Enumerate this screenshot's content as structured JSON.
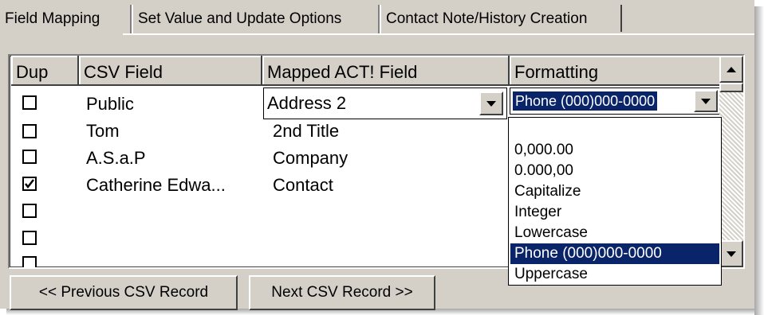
{
  "tabs": [
    {
      "label": "Field Mapping",
      "active": true
    },
    {
      "label": "Set Value and Update Options",
      "active": false
    },
    {
      "label": "Contact Note/History Creation",
      "active": false
    }
  ],
  "grid": {
    "columns": [
      "Dup",
      "CSV Field",
      "Mapped ACT! Field",
      "Formatting"
    ],
    "rows": [
      {
        "dup": false,
        "csv": "Public",
        "mapped": "Address 2",
        "formatting": "Phone (000)000-0000"
      },
      {
        "dup": false,
        "csv": "Tom",
        "mapped": "2nd Title",
        "formatting": ""
      },
      {
        "dup": false,
        "csv": "A.S.a.P",
        "mapped": "Company",
        "formatting": ""
      },
      {
        "dup": true,
        "csv": "Catherine Edwa...",
        "mapped": "Contact",
        "formatting": ""
      },
      {
        "dup": false,
        "csv": "",
        "mapped": "",
        "formatting": ""
      },
      {
        "dup": false,
        "csv": "",
        "mapped": "",
        "formatting": ""
      },
      {
        "dup": false,
        "csv": "",
        "mapped": "",
        "formatting": ""
      }
    ]
  },
  "formatting_dropdown": {
    "selected": "Phone (000)000-0000",
    "options": [
      "",
      "0,000.00",
      "0.000,00",
      "Capitalize",
      "Integer",
      "Lowercase",
      "Phone (000)000-0000",
      "Uppercase"
    ]
  },
  "buttons": {
    "previous": "<< Previous CSV Record",
    "next": "Next CSV Record >>"
  },
  "colors": {
    "face": "#d4d0c8",
    "selection": "#0a246a"
  }
}
